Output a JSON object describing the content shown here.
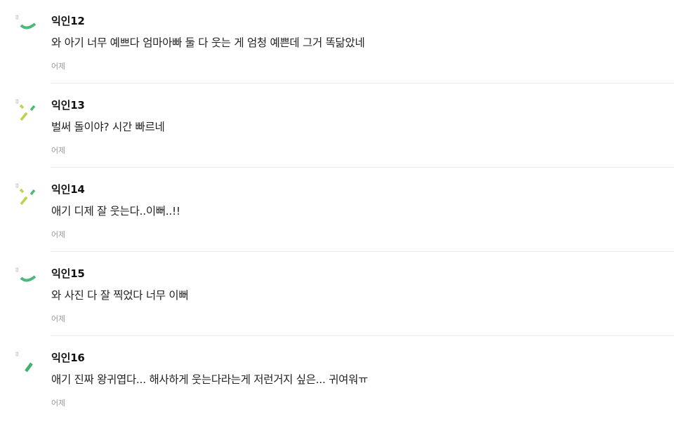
{
  "comments": [
    {
      "nickname": "익인12",
      "text": "와 아기 너무 예쁘다 엄마아빠 둘 다 웃는 게 엄청 예쁜데 그거 똑닮았네",
      "time": "어제",
      "avatar_icon": "green-arc-icon",
      "avatar_color": "#4cb87a"
    },
    {
      "nickname": "익인13",
      "text": "벌써 돌이야? 시간 빠르네",
      "time": "어제",
      "avatar_icon": "lime-dashes-icon",
      "avatar_color": "#b9d34a"
    },
    {
      "nickname": "익인14",
      "text": "애기 디제 잘 웃는다..이뻐..!!",
      "time": "어제",
      "avatar_icon": "lime-dashes-icon",
      "avatar_color": "#b9d34a"
    },
    {
      "nickname": "익인15",
      "text": "와 사진 다 잘 찍었다 너무 이뻐",
      "time": "어제",
      "avatar_icon": "green-arc-icon",
      "avatar_color": "#4cb87a"
    },
    {
      "nickname": "익인16",
      "text": "애기 진짜 왕귀엽다... 해사하게 웃는다라는게 저런거지 싶은... 귀여워ㅠ",
      "time": "어제",
      "avatar_icon": "green-slash-icon",
      "avatar_color": "#3fb36b"
    }
  ]
}
